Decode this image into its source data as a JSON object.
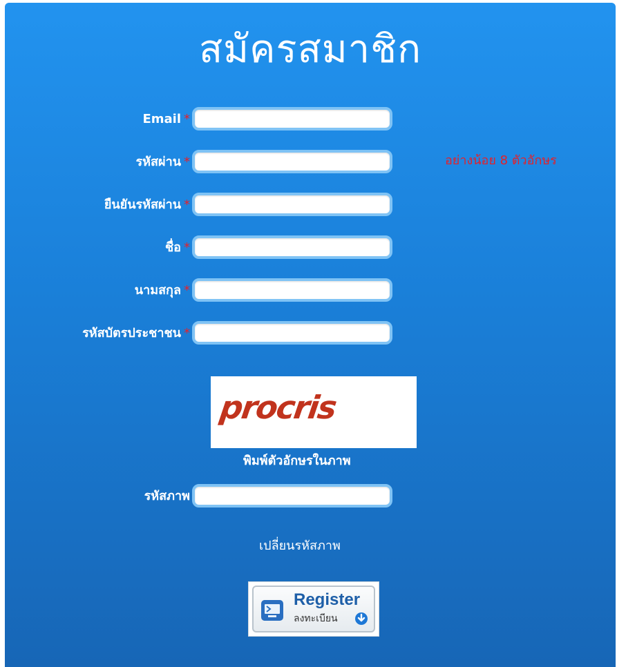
{
  "form": {
    "title": "สมัครสมาชิก",
    "required_mark": "*",
    "fields": [
      {
        "label": "Email",
        "value": ""
      },
      {
        "label": "รหัสผ่าน",
        "value": ""
      },
      {
        "label": "ยืนยันรหัสผ่าน",
        "value": ""
      },
      {
        "label": "ชื่อ",
        "value": ""
      },
      {
        "label": "นามสกุล",
        "value": ""
      },
      {
        "label": "รหัสบัตรประชาชน",
        "value": ""
      }
    ],
    "password_hint": "อย่างน้อย 8 ตัวอักษร"
  },
  "captcha": {
    "image_text": "procris",
    "caption": "พิมพ์ตัวอักษรในภาพ",
    "input_label": "รหัสภาพ",
    "input_value": "",
    "change_label": "เปลี่ยนรหัสภาพ"
  },
  "register_button": {
    "title": "Register",
    "subtitle": "ลงทะเบียน",
    "icon": "computer-icon"
  },
  "colors": {
    "panel_top": "#2293ef",
    "panel_bottom": "#1766b6",
    "required": "#e4212a",
    "captcha_text": "#c1331d",
    "field_border": "#7fc3f5"
  }
}
